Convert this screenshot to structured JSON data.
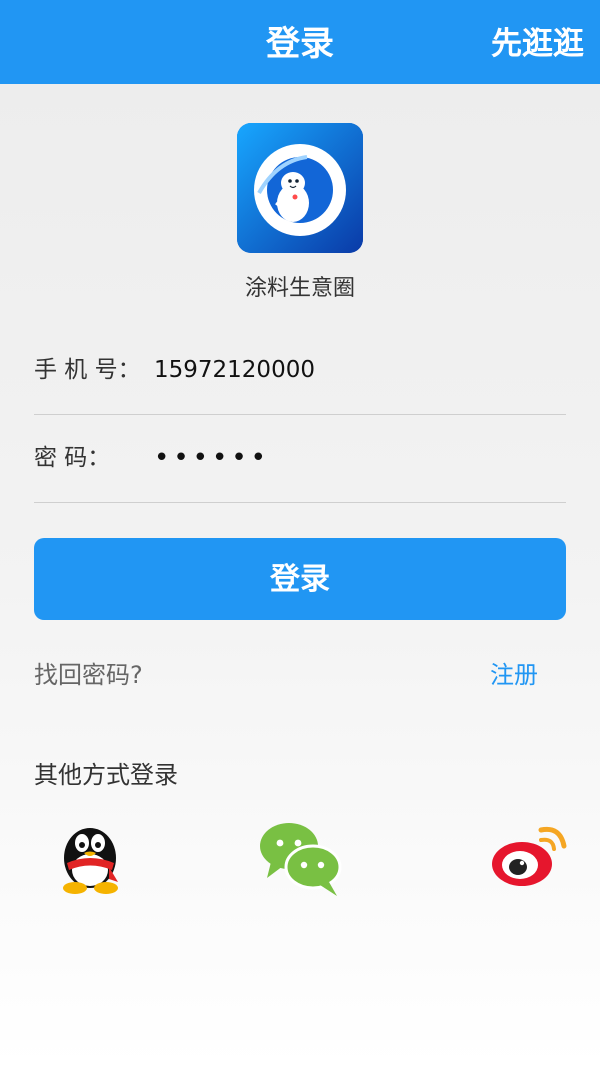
{
  "header": {
    "title": "登录",
    "action": "先逛逛"
  },
  "app": {
    "name": "涂料生意圈",
    "logo_icon": "mascot-logo-icon"
  },
  "form": {
    "phone": {
      "label": "手 机 号：",
      "value": "15972120000"
    },
    "password": {
      "label": "密    码：",
      "value": "••••••"
    },
    "submit_label": "登录"
  },
  "links": {
    "forgot": "找回密码?",
    "register": "注册"
  },
  "social": {
    "title": "其他方式登录",
    "providers": [
      {
        "icon": "qq-icon"
      },
      {
        "icon": "wechat-icon"
      },
      {
        "icon": "weibo-icon"
      }
    ]
  },
  "colors": {
    "primary": "#2196f3",
    "logo_bg": "#0b5fd3"
  }
}
